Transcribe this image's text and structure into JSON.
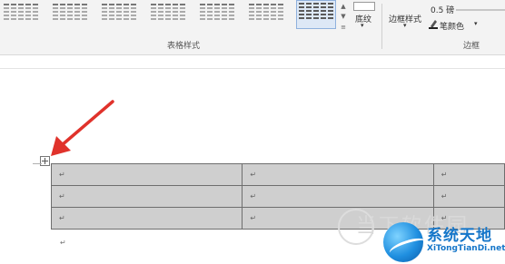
{
  "ribbon": {
    "gallery": {
      "group_label": "表格样式",
      "style_count": 7,
      "selected_index": 6
    },
    "shading": {
      "label": "底纹"
    },
    "borders": {
      "group_label": "边框",
      "border_styles_label": "边框样式",
      "line_weight": "0.5 磅",
      "pen_color_label": "笔颜色"
    }
  },
  "document": {
    "table": {
      "rows": [
        [
          "↵",
          "↵",
          "↵"
        ],
        [
          "↵",
          "↵",
          "↵"
        ],
        [
          "↵",
          "↵",
          "↵"
        ]
      ]
    },
    "paragraph_mark": "↵"
  },
  "watermark": {
    "site_text": "当下软件园",
    "logo_cn": "系统天地",
    "logo_en": "XiTongTianDi.net"
  },
  "colors": {
    "ribbon_bg": "#f3f3f3",
    "table_fill": "#cfcfcf",
    "arrow": "#e0322b",
    "logo_blue": "#1576c9"
  }
}
